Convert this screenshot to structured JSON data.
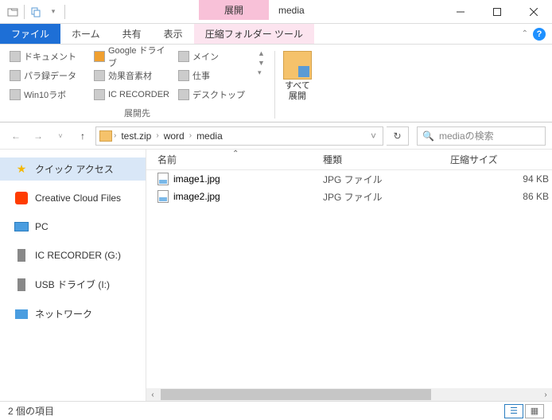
{
  "window": {
    "context_tab": "展開",
    "title": "media"
  },
  "tabs": {
    "file": "ファイル",
    "home": "ホーム",
    "share": "共有",
    "view": "表示",
    "context": "圧縮フォルダー ツール"
  },
  "ribbon": {
    "destinations": [
      "ドキュメント",
      "Google ドライブ",
      "メイン",
      "パラ録データ",
      "効果音素材",
      "仕事",
      "Win10ラボ",
      "IC RECORDER",
      "デスクトップ"
    ],
    "group1_label": "展開先",
    "extract_all_1": "すべて",
    "extract_all_2": "展開"
  },
  "breadcrumb": [
    "test.zip",
    "word",
    "media"
  ],
  "search": {
    "placeholder": "mediaの検索"
  },
  "sidebar": {
    "quick": "クイック アクセス",
    "cc": "Creative Cloud Files",
    "pc": "PC",
    "rec": "IC RECORDER (G:)",
    "usb": "USB ドライブ (I:)",
    "net": "ネットワーク"
  },
  "columns": {
    "name": "名前",
    "type": "種類",
    "size": "圧縮サイズ"
  },
  "files": [
    {
      "name": "image1.jpg",
      "type": "JPG ファイル",
      "size": "94 KB"
    },
    {
      "name": "image2.jpg",
      "type": "JPG ファイル",
      "size": "86 KB"
    }
  ],
  "status": {
    "items": "2 個の項目"
  }
}
